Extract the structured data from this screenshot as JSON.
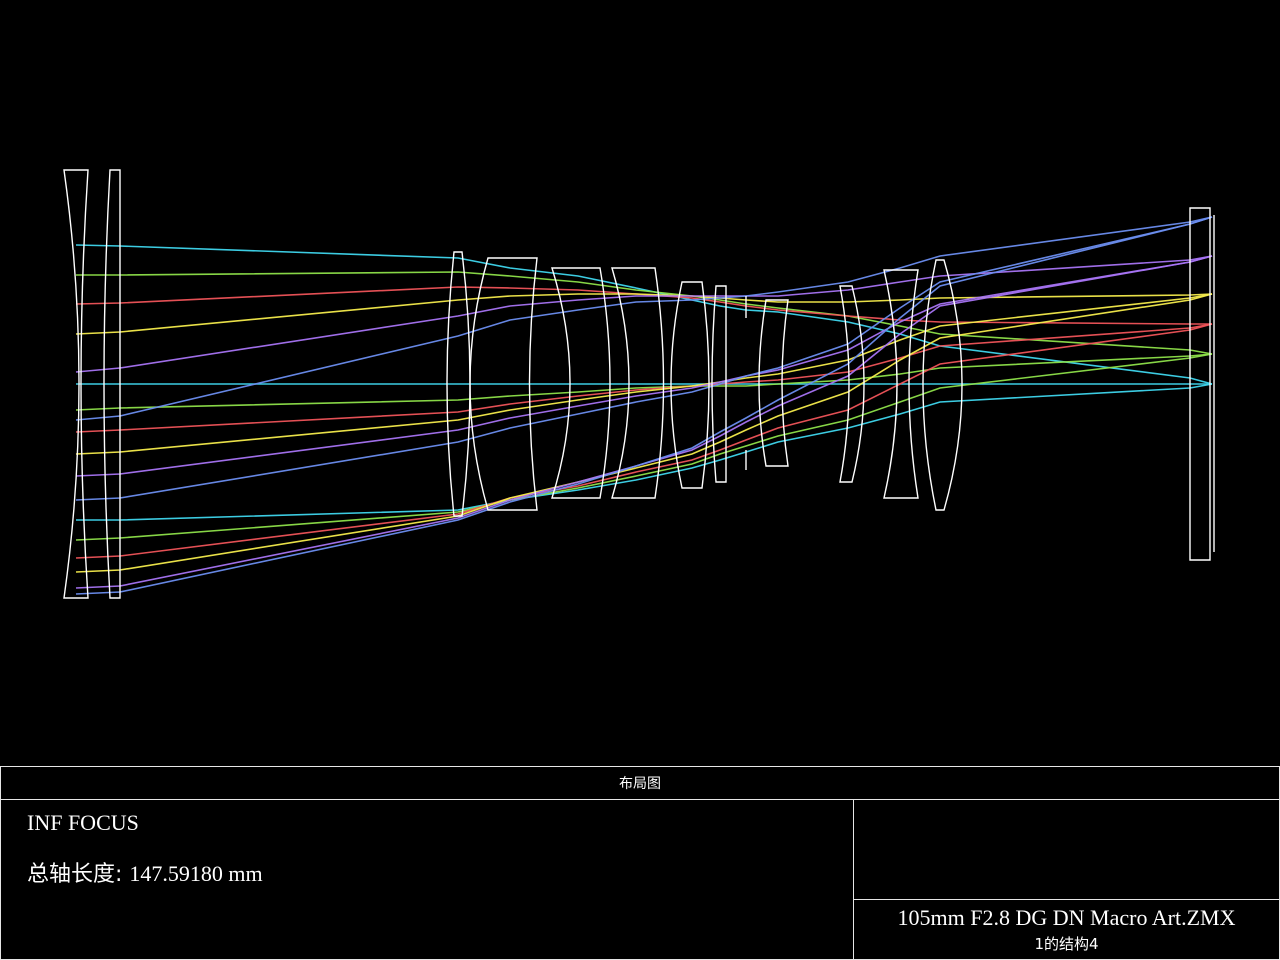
{
  "layout_title": "布局图",
  "focus_label": "INF FOCUS",
  "total_length_label": "总轴长度:",
  "total_length_value": "147.59180 mm",
  "file_name": "105mm F2.8 DG DN Macro Art.ZMX",
  "configuration_label": "1的结构4",
  "colors": {
    "background": "#000000",
    "lens": "#ffffff",
    "rays": [
      "#3fd7ee",
      "#8ee24a",
      "#f0545a",
      "#f5ec4c",
      "#a874f4",
      "#6b8ef0"
    ]
  }
}
